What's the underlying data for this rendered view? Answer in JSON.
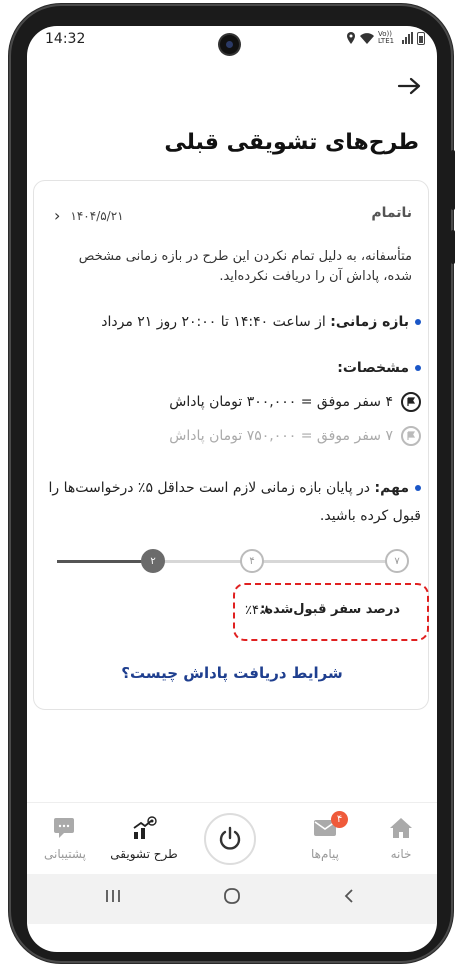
{
  "status_bar": {
    "time": "14:32",
    "network_label": "Vo)) LTE1",
    "icons": [
      "location-icon",
      "wifi-icon",
      "signal-icon",
      "battery-icon"
    ]
  },
  "header": {
    "back_icon": "arrow-right-icon",
    "title": "طرح‌های تشویقی قبلی"
  },
  "card": {
    "status": "ناتمام",
    "date": "۱۴۰۴/۵/۲۱",
    "description": "متأسفانه، به دلیل تمام نکردن این طرح در بازه زمانی مشخص شده، پاداش آن را دریافت نکرده‌اید.",
    "time_range_label": "بازه زمانی:",
    "time_range_value": "از ساعت ۱۴:۴۰ تا ۲۰:۰۰ روز ۲۱ مرداد",
    "specs_label": "مشخصات:",
    "specs": [
      {
        "text": "۴ سفر موفق = ۳۰۰,۰۰۰ تومان پاداش",
        "achieved": false,
        "highlight": true
      },
      {
        "text": "۷ سفر موفق = ۷۵۰,۰۰۰ تومان پاداش",
        "achieved": false,
        "highlight": false
      }
    ],
    "important_label": "مهم:",
    "important_text": "در پایان بازه زمانی لازم است حداقل ۵٪ درخواست‌ها را قبول کرده باشید.",
    "progress": {
      "current": 2,
      "nodes": [
        "۷",
        "۴",
        "۲"
      ]
    },
    "accept_rate_label": "درصد سفر قبول‌شده:",
    "accept_rate_value": "٪۴.۸",
    "conditions_link": "شرایط دریافت پاداش چیست؟"
  },
  "bottom_nav": {
    "items": [
      {
        "label": "خانه",
        "icon": "home-icon",
        "active": false
      },
      {
        "label": "پیام‌ها",
        "icon": "mail-icon",
        "active": false,
        "badge": "۴"
      },
      {
        "label": "",
        "icon": "power-icon",
        "active": false
      },
      {
        "label": "طرح تشویقی",
        "icon": "incentive-chart-icon",
        "active": true
      },
      {
        "label": "پشتیبانی",
        "icon": "support-chat-icon",
        "active": false
      }
    ]
  },
  "system_nav": {
    "icons": [
      "recents-icon",
      "home-circle-icon",
      "back-chevron-icon"
    ]
  },
  "colors": {
    "accent_blue": "#1a56c7",
    "link_blue": "#1f3f8f",
    "highlight_red": "#e02020",
    "badge_orange": "#ef5a3a"
  }
}
